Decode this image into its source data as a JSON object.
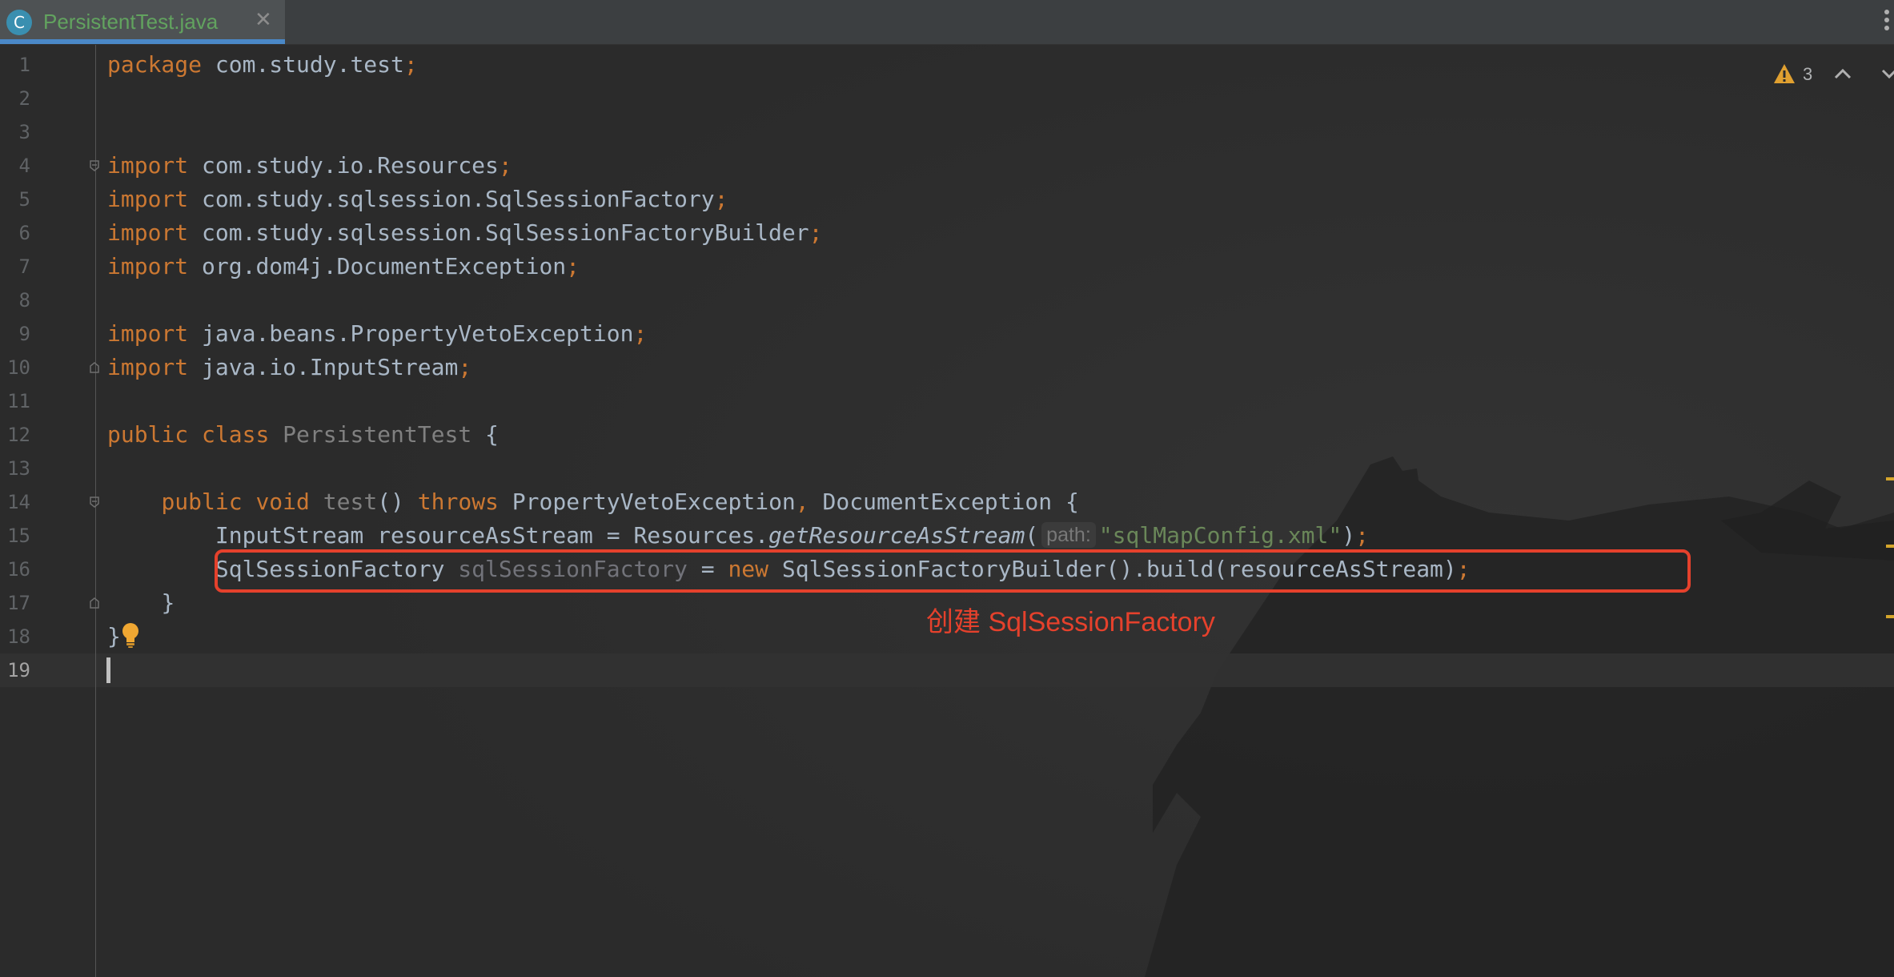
{
  "tab": {
    "icon_letter": "C",
    "filename": "PersistentTest.java",
    "close_glyph": "✕"
  },
  "inspection": {
    "warning_count": "3"
  },
  "annotation": "创建 SqlSessionFactory",
  "line_numbers": [
    "1",
    "2",
    "3",
    "4",
    "5",
    "6",
    "7",
    "8",
    "9",
    "10",
    "11",
    "12",
    "13",
    "14",
    "15",
    "16",
    "17",
    "18",
    "19"
  ],
  "code": {
    "l1": {
      "kw": "package",
      "rest": " com.study.test",
      "semi": ";"
    },
    "l4": {
      "kw": "import",
      "rest": " com.study.io.Resources",
      "semi": ";"
    },
    "l5": {
      "kw": "import",
      "rest": " com.study.sqlsession.SqlSessionFactory",
      "semi": ";"
    },
    "l6": {
      "kw": "import",
      "rest": " com.study.sqlsession.SqlSessionFactoryBuilder",
      "semi": ";"
    },
    "l7": {
      "kw": "import",
      "rest": " org.dom4j.DocumentException",
      "semi": ";"
    },
    "l9": {
      "kw": "import",
      "rest": " java.beans.PropertyVetoException",
      "semi": ";"
    },
    "l10": {
      "kw": "import",
      "rest": " java.io.InputStream",
      "semi": ";"
    },
    "l12": {
      "kw1": "public",
      "kw2": "class",
      "name": "PersistentTest",
      "brace": " {"
    },
    "l14": {
      "indent": "    ",
      "kw1": "public",
      "kw2": "void",
      "method": "test",
      "parens": "()",
      "kw3": "throws",
      "ex1": "PropertyVetoException",
      "comma": ",",
      "ex2": " DocumentException {"
    },
    "l15": {
      "indent": "        ",
      "left": "InputStream resourceAsStream = Resources.",
      "call": "getResourceAsStream",
      "open": "(",
      "hint": "path:",
      "str": "\"sqlMapConfig.xml\"",
      "close": ")",
      "semi": ";"
    },
    "l16": {
      "indent": "        ",
      "type": "SqlSessionFactory",
      "var": "sqlSessionFactory",
      "eq": " = ",
      "kw": "new",
      "rest": " SqlSessionFactoryBuilder().build(resourceAsStream)",
      "semi": ";"
    },
    "l17": {
      "indent": "    ",
      "brace": "}"
    },
    "l18": {
      "brace": "}"
    }
  }
}
